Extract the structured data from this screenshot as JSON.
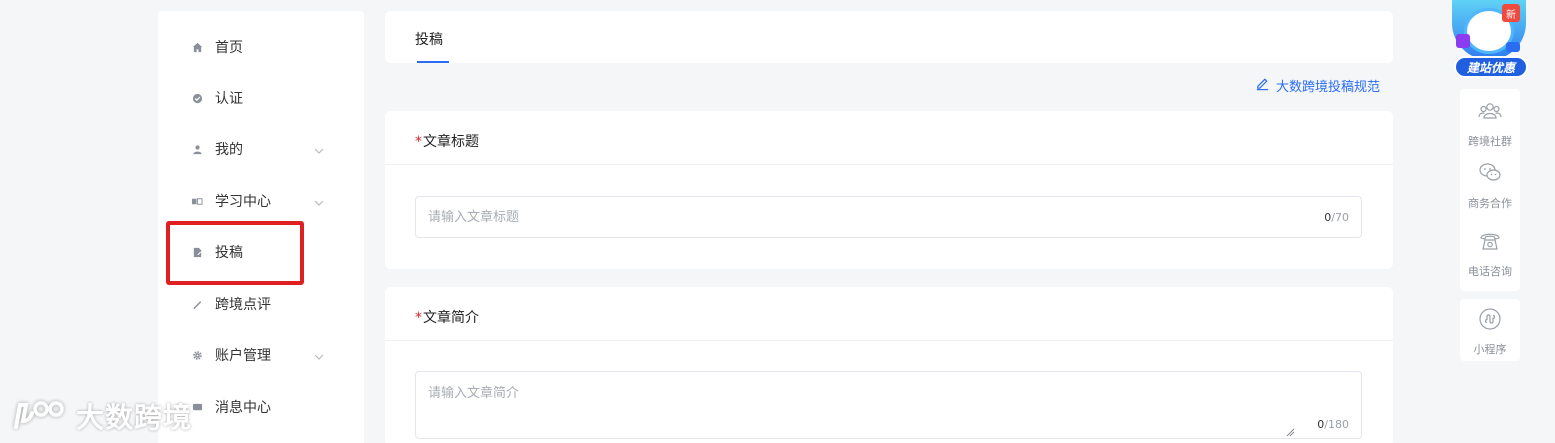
{
  "sidebar": {
    "items": [
      {
        "label": "首页",
        "icon": "home-icon"
      },
      {
        "label": "认证",
        "icon": "verified-icon"
      },
      {
        "label": "我的",
        "icon": "user-icon",
        "expandable": true
      },
      {
        "label": "学习中心",
        "icon": "book-icon",
        "expandable": true
      },
      {
        "label": "投稿",
        "icon": "submit-document-icon",
        "active": true
      },
      {
        "label": "跨境点评",
        "icon": "pencil-icon"
      },
      {
        "label": "账户管理",
        "icon": "gear-icon",
        "expandable": true
      },
      {
        "label": "消息中心",
        "icon": "message-icon"
      }
    ],
    "highlight_color": "#e02020"
  },
  "header": {
    "tab_label": "投稿"
  },
  "guide_link": {
    "label": "大数跨境投稿规范"
  },
  "form": {
    "title_field": {
      "required_mark": "*",
      "label": "文章标题",
      "placeholder": "请输入文章标题",
      "count": "0",
      "max": "/70"
    },
    "intro_field": {
      "required_mark": "*",
      "label": "文章简介",
      "placeholder": "请输入文章简介",
      "count": "0",
      "max": "/180"
    }
  },
  "floating_bar": {
    "promo": {
      "badge": "新",
      "label": "建站优惠"
    },
    "items": [
      {
        "label": "跨境社群",
        "icon": "community-icon"
      },
      {
        "label": "商务合作",
        "icon": "wechat-icon"
      },
      {
        "label": "电话咨询",
        "icon": "phone-icon"
      },
      {
        "label": "小程序",
        "icon": "mini-program-icon"
      }
    ]
  },
  "watermark": {
    "text": "大数跨境"
  },
  "colors": {
    "accent": "#2a6df4",
    "required": "#e02020",
    "background": "#f5f6f8"
  }
}
